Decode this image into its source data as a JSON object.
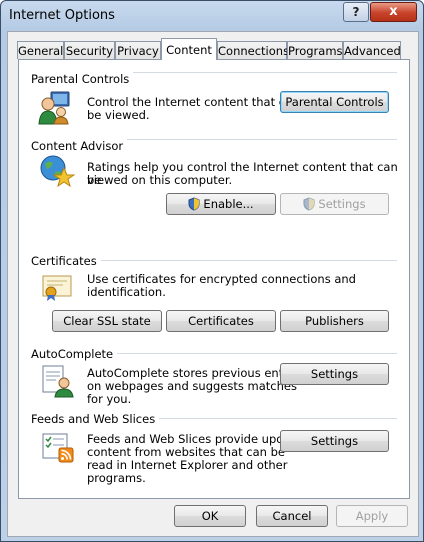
{
  "window": {
    "title": "Internet Options",
    "help_glyph": "?",
    "close_glyph": "x"
  },
  "tabs": [
    "General",
    "Security",
    "Privacy",
    "Content",
    "Connections",
    "Programs",
    "Advanced"
  ],
  "active_tab": "Content",
  "parental": {
    "title": "Parental Controls",
    "desc_line1": "Control the Internet content that can",
    "desc_line2": "be viewed.",
    "button": "Parental Controls"
  },
  "advisor": {
    "title": "Content Advisor",
    "desc_line1": "Ratings help you control the Internet content that can be",
    "desc_line2": "viewed on this computer.",
    "enable_button": "Enable...",
    "settings_button": "Settings"
  },
  "certificates": {
    "title": "Certificates",
    "desc": "Use certificates for encrypted connections and identification.",
    "clear_ssl_button": "Clear SSL state",
    "certificates_button": "Certificates",
    "publishers_button": "Publishers"
  },
  "autocomplete": {
    "title": "AutoComplete",
    "desc_line1": "AutoComplete stores previous entries",
    "desc_line2": "on webpages and suggests matches",
    "desc_line3": "for you.",
    "settings_button": "Settings"
  },
  "feeds": {
    "title": "Feeds and Web Slices",
    "desc_line1": "Feeds and Web Slices provide updated",
    "desc_line2": "content from websites that can be",
    "desc_line3": "read in Internet Explorer and other",
    "desc_line4": "programs.",
    "settings_button": "Settings"
  },
  "footer": {
    "ok": "OK",
    "cancel": "Cancel",
    "apply": "Apply"
  },
  "icons": [
    "parental-icon",
    "content-advisor-globe-icon",
    "certificate-icon",
    "autocomplete-icon",
    "feeds-icon",
    "shield-icon"
  ]
}
